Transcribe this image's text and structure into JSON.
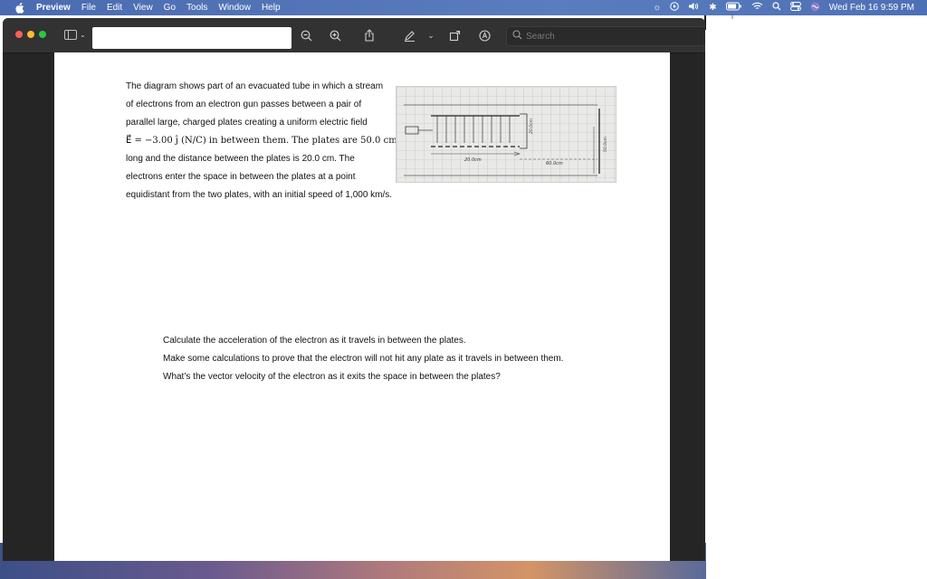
{
  "menubar": {
    "app_name": "Preview",
    "menus": [
      "File",
      "Edit",
      "View",
      "Go",
      "Tools",
      "Window",
      "Help"
    ],
    "clock": "Wed Feb 16  9:59 PM"
  },
  "toolbar": {
    "title_field_value": "",
    "search_placeholder": "Search"
  },
  "document": {
    "paragraph_lines": [
      "The diagram shows part of an evacuated tube in which a stream",
      "of electrons from an electron gun passes between a pair of",
      "parallel large, charged plates creating a uniform electric field",
      "E⃗ = −3.00 ĵ (N/C) in between them. The plates are 50.0 cm",
      "long and the distance between the plates is 20.0 cm. The",
      "electrons enter the space in between the plates at a point",
      "equidistant from the two plates, with an initial speed of 1,000 km/s."
    ],
    "figure_labels": [
      "20.0cm",
      "50.0cm",
      "60.0cm",
      "20.0cm"
    ],
    "questions": [
      "Calculate the acceleration of the electron as it travels in between the plates.",
      "Make some calculations to prove that the electron will not hit any plate as it travels in between them.",
      "What’s the vector velocity of the electron as it exits the space in between the plates?"
    ]
  },
  "colors": {
    "menubar": "#4f72b8",
    "window_bg": "#252525",
    "toolbar_bg": "#323232",
    "close": "#fe5f57",
    "minimize": "#febb2e",
    "zoom": "#28c840"
  }
}
